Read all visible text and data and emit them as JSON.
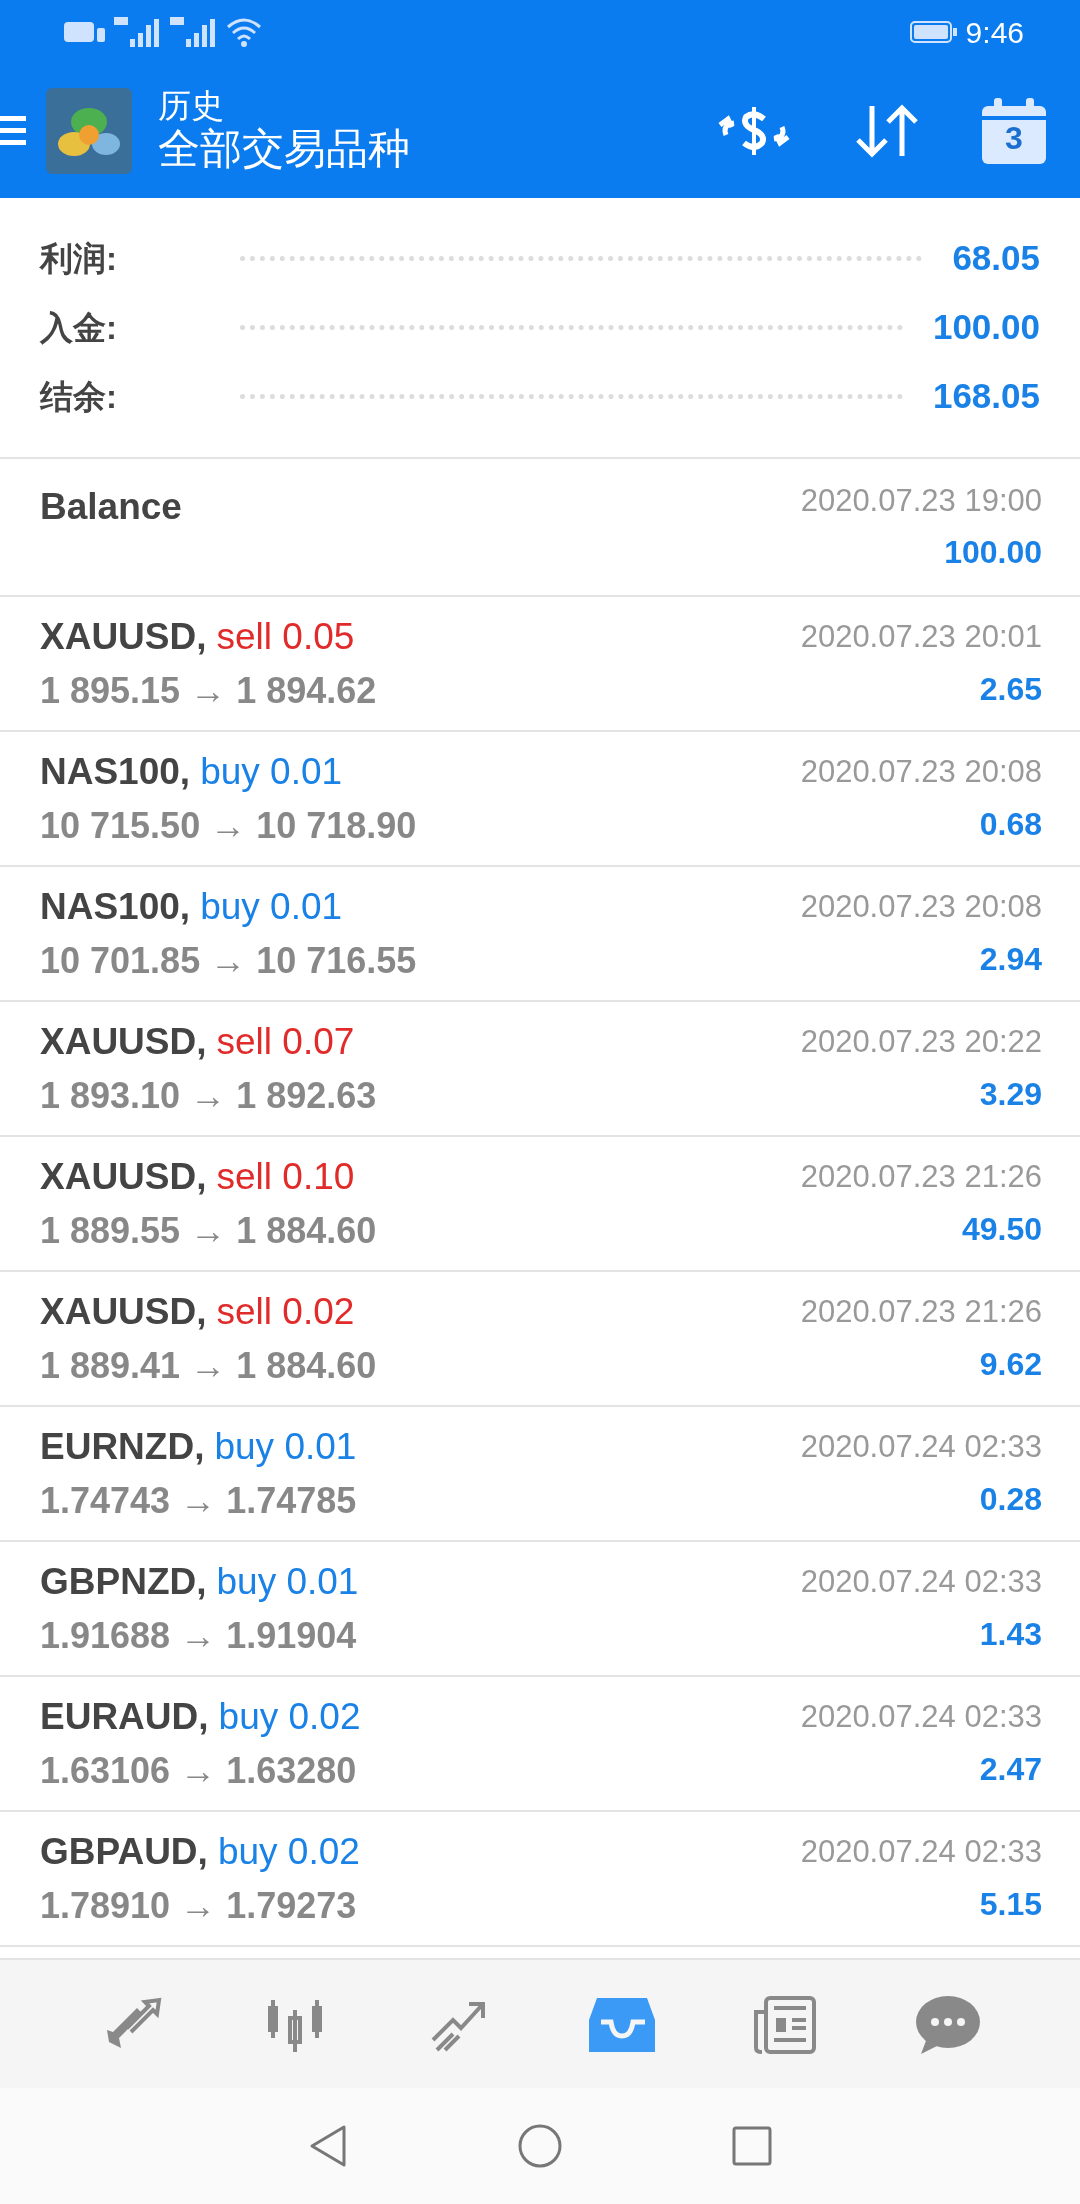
{
  "status_bar": {
    "time": "9:46"
  },
  "header": {
    "subtitle": "历史",
    "title": "全部交易品种",
    "calendar_day": "3"
  },
  "summary": [
    {
      "label": "利润:",
      "value": "68.05"
    },
    {
      "label": "入金:",
      "value": "100.00"
    },
    {
      "label": "结余:",
      "value": "168.05"
    }
  ],
  "balance": {
    "label": "Balance",
    "time": "2020.07.23 19:00",
    "amount": "100.00"
  },
  "trades": [
    {
      "symbol": "XAUUSD,",
      "order": "sell 0.05",
      "kind": "sell",
      "prices": "1 895.15 → 1 894.62",
      "time": "2020.07.23 20:01",
      "profit": "2.65"
    },
    {
      "symbol": "NAS100,",
      "order": "buy 0.01",
      "kind": "buy",
      "prices": "10 715.50 → 10 718.90",
      "time": "2020.07.23 20:08",
      "profit": "0.68"
    },
    {
      "symbol": "NAS100,",
      "order": "buy 0.01",
      "kind": "buy",
      "prices": "10 701.85 → 10 716.55",
      "time": "2020.07.23 20:08",
      "profit": "2.94"
    },
    {
      "symbol": "XAUUSD,",
      "order": "sell 0.07",
      "kind": "sell",
      "prices": "1 893.10 → 1 892.63",
      "time": "2020.07.23 20:22",
      "profit": "3.29"
    },
    {
      "symbol": "XAUUSD,",
      "order": "sell 0.10",
      "kind": "sell",
      "prices": "1 889.55 → 1 884.60",
      "time": "2020.07.23 21:26",
      "profit": "49.50"
    },
    {
      "symbol": "XAUUSD,",
      "order": "sell 0.02",
      "kind": "sell",
      "prices": "1 889.41 → 1 884.60",
      "time": "2020.07.23 21:26",
      "profit": "9.62"
    },
    {
      "symbol": "EURNZD,",
      "order": "buy 0.01",
      "kind": "buy",
      "prices": "1.74743 → 1.74785",
      "time": "2020.07.24 02:33",
      "profit": "0.28"
    },
    {
      "symbol": "GBPNZD,",
      "order": "buy 0.01",
      "kind": "buy",
      "prices": "1.91688 → 1.91904",
      "time": "2020.07.24 02:33",
      "profit": "1.43"
    },
    {
      "symbol": "EURAUD,",
      "order": "buy 0.02",
      "kind": "buy",
      "prices": "1.63106 → 1.63280",
      "time": "2020.07.24 02:33",
      "profit": "2.47"
    },
    {
      "symbol": "GBPAUD,",
      "order": "buy 0.02",
      "kind": "buy",
      "prices": "1.78910 → 1.79273",
      "time": "2020.07.24 02:33",
      "profit": "5.15"
    }
  ],
  "bottom_nav": [
    {
      "kind": "quotes",
      "selected": false
    },
    {
      "kind": "chart",
      "selected": false
    },
    {
      "kind": "trade",
      "selected": false
    },
    {
      "kind": "history",
      "selected": true
    },
    {
      "kind": "news",
      "selected": false
    },
    {
      "kind": "chat",
      "selected": false
    }
  ]
}
